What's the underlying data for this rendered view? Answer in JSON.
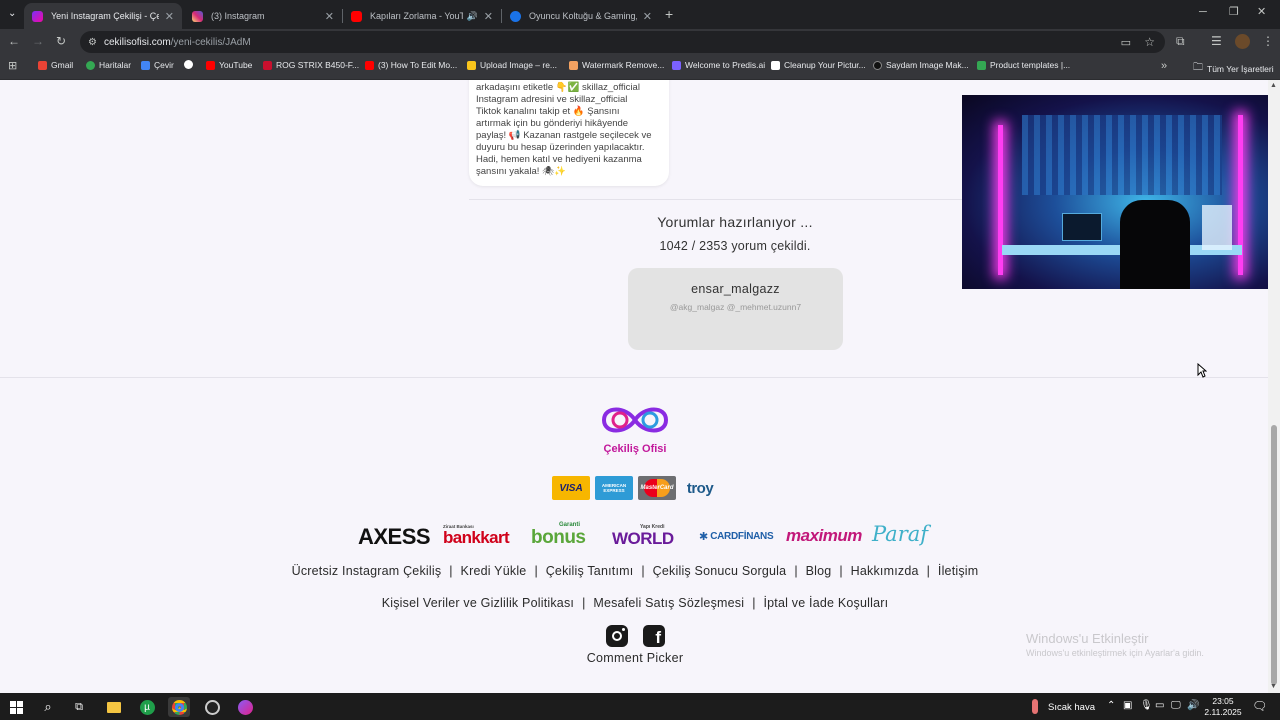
{
  "browser": {
    "tabs": [
      {
        "title": "Yeni Instagram Çekilişi - Çekiliş",
        "active": true
      },
      {
        "title": "(3) Instagram",
        "active": false
      },
      {
        "title": "Kapıları Zorlama - YouTube",
        "active": false
      },
      {
        "title": "Oyuncu Koltuğu & Gaming, Ga",
        "active": false
      }
    ],
    "url_domain": "cekilisofisi.com",
    "url_path": "/yeni-cekilis/JAdM",
    "bookmarks": [
      "Gmail",
      "Haritalar",
      "Çevir",
      "",
      "YouTube",
      "ROG STRIX B450-F...",
      "(3) How To Edit Mo...",
      "Upload Image – re...",
      "Watermark Remove...",
      "Welcome to Predis.ai",
      "Cleanup Your Pictur...",
      "Saydam Image Mak...",
      "Product templates |..."
    ],
    "all_bookmarks": "Tüm Yer İşaretleri"
  },
  "post": {
    "caption_lines": [
      "arkadaşını etiketle 👇✅ skillaz_official",
      "Instagram adresini ve skillaz_official",
      "Tiktok kanalını takip et 🔥 Şansını",
      "artırmak için bu gönderiyi hikâyende",
      "paylaş! 📢 Kazanan rastgele seçilecek ve",
      "duyuru bu hesap üzerinden yapılacaktır.",
      "Hadi, hemen katıl ve hediyeni kazanma",
      "şansını yakala! 🕷✨"
    ]
  },
  "progress": {
    "status": "Yorumlar hazırlanıyor ...",
    "count_text": "1042 / 2353 yorum çekildi.",
    "fraction": 0.443
  },
  "comment_card": {
    "username": "ensar_malgazz",
    "mentions": "@akg_malgaz @_mehmet.uzunn7"
  },
  "footer": {
    "brand": "Çekiliş Ofisi",
    "cards": [
      "VISA",
      "AMERICAN EXPRESS",
      "MasterCard",
      "troy"
    ],
    "banks": [
      "AXESS",
      "Ziraat Bankası",
      "bankkart",
      "Garanti",
      "bonus",
      "Yapı Kredi",
      "WORLD",
      "CARDFİNANS",
      "maximum",
      "Paraf"
    ],
    "links_row1": [
      "Ücretsiz Instagram Çekiliş",
      "Kredi Yükle",
      "Çekiliş Tanıtımı",
      "Çekiliş Sonucu Sorgula",
      "Blog",
      "Hakkımızda",
      "İletişim"
    ],
    "links_row2": [
      "Kişisel Veriler ve Gizlilik Politikası",
      "Mesafeli Satış Sözleşmesi",
      "İptal ve İade Koşulları"
    ],
    "app_label": "Comment Picker"
  },
  "watermark": {
    "title": "Windows'u Etkinleştir",
    "subtitle": "Windows'u etkinleştirmek için Ayarlar'a gidin."
  },
  "taskbar": {
    "weather": "Sıcak hava",
    "time": "23:05",
    "date": "2.11.2025"
  },
  "colors": {
    "page_bg": "#f7f5fb",
    "brand_purple": "#8a2be2",
    "brand_pink": "#e0218a",
    "card_bg": "#e3e3e3"
  }
}
